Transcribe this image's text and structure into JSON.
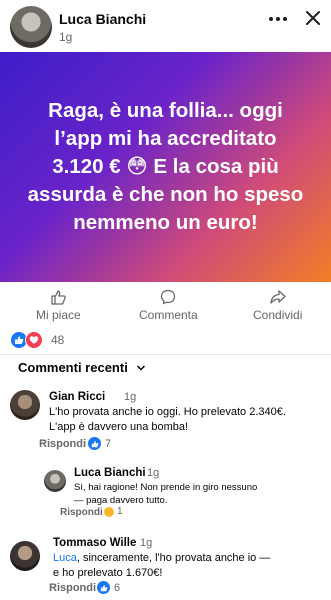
{
  "post": {
    "author": "Luca Bianchi",
    "time": "1g",
    "text": "Raga, è una follia... oggi\nl’app mi ha accreditato\n3.120 € 😳 E la cosa più\nassurda è che non ho speso\nnemmeno un euro!",
    "gradient_colors": [
      "#3d1ec9",
      "#6a23c9",
      "#d04b78",
      "#f27f25"
    ]
  },
  "actions": {
    "like": "Mi piace",
    "comment": "Commenta",
    "share": "Condividi"
  },
  "reactions": {
    "count": "48"
  },
  "comments_header": "Commenti recenti",
  "comments": [
    {
      "name": "Gian Ricci",
      "time": "1g",
      "text": "L'ho provata anche io oggi. Ho prelevato 2.340€.\nL'app è davvero una bomba!",
      "reply": "Rispondi",
      "reactions": "7"
    },
    {
      "name": "Luca Bianchi",
      "time": "1g",
      "text": "Sì, hai ragione! Non prende in giro nessuno\n— paga davvero tutto.",
      "reply": "Rispondi",
      "reactions": "1"
    },
    {
      "name": "Tommaso Wille",
      "time": "1g",
      "mention": "Luca",
      "text": ", sinceramente, l'ho provata anche io —\ne ho prelevato 1.670€!",
      "reply": "Rispondi",
      "reactions": "6"
    }
  ]
}
